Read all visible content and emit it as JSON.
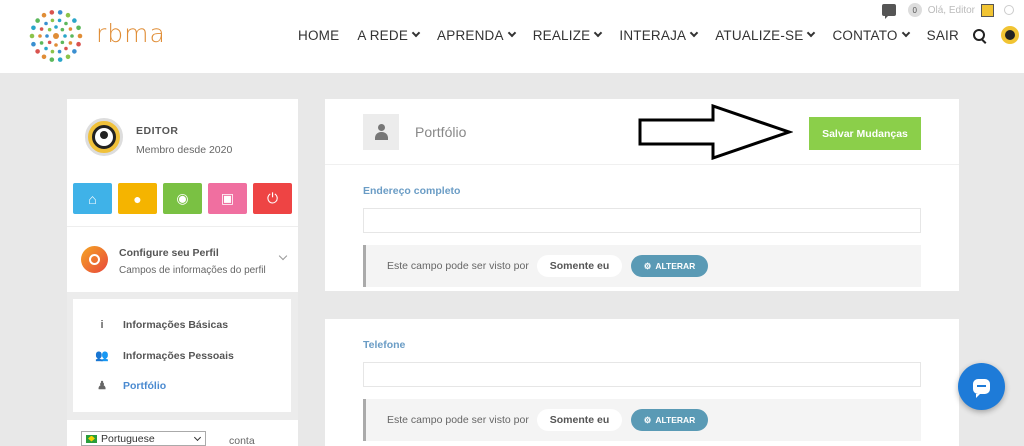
{
  "brand": {
    "name": "rbma"
  },
  "topbar": {
    "notif_count": "0",
    "user_label": "Olá, Editor"
  },
  "nav": {
    "items": [
      {
        "label": "HOME",
        "caret": false
      },
      {
        "label": "A REDE",
        "caret": true
      },
      {
        "label": "APRENDA",
        "caret": true
      },
      {
        "label": "REALIZE",
        "caret": true
      },
      {
        "label": "INTERAJA",
        "caret": true
      },
      {
        "label": "ATUALIZE-SE",
        "caret": true
      },
      {
        "label": "CONTATO",
        "caret": true
      },
      {
        "label": "SAIR",
        "caret": false
      }
    ]
  },
  "sidebar": {
    "profile_name": "EDITOR",
    "profile_since": "Membro desde 2020",
    "quick_icons": [
      {
        "name": "home-icon",
        "color": "#3fb2e8",
        "glyph": "⌂"
      },
      {
        "name": "user-icon",
        "color": "#f5b400",
        "glyph": "●"
      },
      {
        "name": "account-icon",
        "color": "#7ac143",
        "glyph": "◉"
      },
      {
        "name": "card-icon",
        "color": "#f06fa0",
        "glyph": "▣"
      },
      {
        "name": "power-icon",
        "color": "#ee4444",
        "glyph": "⏻"
      }
    ],
    "config_title": "Configure seu Perfil",
    "config_sub": "Campos de informações do perfil",
    "submenu": [
      {
        "label": "Informações Básicas",
        "icon": "info-icon",
        "glyph": "i",
        "active": false
      },
      {
        "label": "Informações Pessoais",
        "icon": "users-icon",
        "glyph": "👥",
        "active": false
      },
      {
        "label": "Portfólio",
        "icon": "person-icon",
        "glyph": "♟",
        "active": true
      }
    ],
    "language": "Portuguese",
    "partial_text": "conta"
  },
  "panel": {
    "title": "Portfólio",
    "save_label": "Salvar Mudanças",
    "fields": [
      {
        "label": "Endereço completo",
        "value": "",
        "visibility_text": "Este campo pode ser visto por",
        "visibility_value": "Somente eu",
        "change_label": "ALTERAR"
      },
      {
        "label": "Telefone",
        "value": "",
        "visibility_text": "Este campo pode ser visto por",
        "visibility_value": "Somente eu",
        "change_label": "ALTERAR"
      }
    ]
  },
  "colors": {
    "accent_green": "#8bcf4a",
    "accent_blue": "#5a9ab5",
    "label_blue": "#6a9cc5",
    "chat_blue": "#1e7bd8"
  }
}
